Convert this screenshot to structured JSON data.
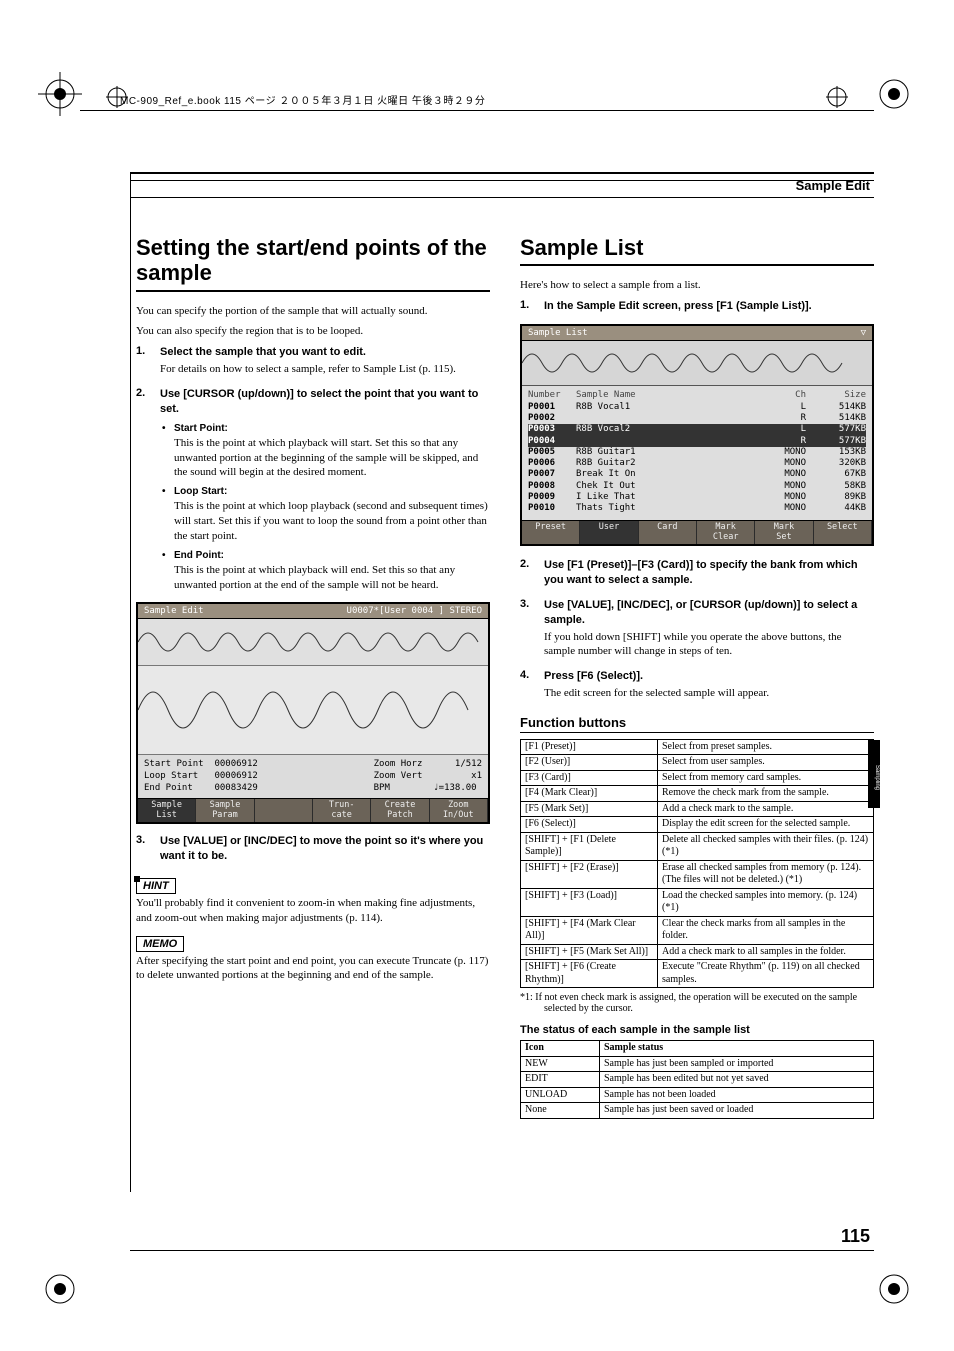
{
  "book_header": "MC-909_Ref_e.book 115 ページ ２００５年３月１日 火曜日 午後３時２９分",
  "page_header": "Sample Edit",
  "page_number": "115",
  "side_tab": "Sampling",
  "left": {
    "h2": "Setting the start/end points of the sample",
    "intro1": "You can specify the portion of the sample that will actually sound.",
    "intro2": "You can also specify the region that is to be looped.",
    "steps": [
      {
        "head": "Select the sample that you want to edit.",
        "body": "For details on how to select a sample, refer to Sample List (p. 115)."
      },
      {
        "head": "Use [CURSOR (up/down)] to select the point that you want to set.",
        "bullets": [
          {
            "label": "Start Point:",
            "desc": "This is the point at which playback will start. Set this so that any unwanted portion at the beginning of the sample will be skipped, and the sound will begin at the desired moment."
          },
          {
            "label": "Loop Start:",
            "desc": "This is the point at which loop playback (second and subsequent times) will start. Set this if you want to loop the sound from a point other than the start point."
          },
          {
            "label": "End Point:",
            "desc": "This is the point at which playback will end. Set this so that any unwanted portion at the end of the sample will not be heard."
          }
        ]
      },
      {
        "head": "Use [VALUE] or [INC/DEC] to move the point so it's where you want it to be."
      }
    ],
    "sshot": {
      "title_left": "Sample Edit",
      "title_right": "U0007*[User 0004         ] STEREO",
      "params_left": [
        "Start Point  00006912",
        "Loop Start   00006912",
        "End Point    00083429"
      ],
      "params_right": [
        "Zoom Horz      1/512",
        "Zoom Vert         x1",
        "BPM        ♩=138.00"
      ],
      "fkeys": [
        "Sample\nList",
        "Sample\nParam",
        "",
        "Trun-\ncate",
        "Create\nPatch",
        "Zoom\nIn/Out"
      ]
    },
    "hint_tag": "HINT",
    "hint_body": "You'll probably find it convenient to zoom-in when making fine adjustments, and zoom-out when making major adjustments (p. 114).",
    "memo_tag": "MEMO",
    "memo_body": "After specifying the start point and end point, you can execute Truncate (p. 117) to delete unwanted portions at the beginning and end of the sample."
  },
  "right": {
    "h2": "Sample List",
    "intro": "Here's how to select a sample from a list.",
    "steps": [
      {
        "head": "In the Sample Edit screen, press [F1 (Sample List)]."
      },
      {
        "head": "Use [F1 (Preset)]–[F3 (Card)] to specify the bank from which you want to select a sample."
      },
      {
        "head": "Use [VALUE], [INC/DEC], or [CURSOR (up/down)] to select a sample.",
        "body": "If you hold down [SHIFT] while you operate the above buttons, the sample number will change in steps of ten."
      },
      {
        "head": "Press [F6 (Select)].",
        "body": "The edit screen for the selected sample will appear."
      }
    ],
    "sl_sshot": {
      "title": "Sample List",
      "head": [
        "Number",
        "Sample Name",
        "Ch",
        "Size"
      ],
      "rows": [
        {
          "n": "P0001",
          "name": "R8B Vocal1",
          "ch": "L",
          "size": "514KB"
        },
        {
          "n": "P0002",
          "name": "",
          "ch": "R",
          "size": "514KB"
        },
        {
          "n": "P0003",
          "name": "R8B Vocal2",
          "ch": "L",
          "size": "577KB",
          "sel": true
        },
        {
          "n": "P0004",
          "name": "",
          "ch": "R",
          "size": "577KB",
          "sel": true
        },
        {
          "n": "P0005",
          "name": "R8B Guitar1",
          "ch": "MONO",
          "size": "153KB"
        },
        {
          "n": "P0006",
          "name": "R8B Guitar2",
          "ch": "MONO",
          "size": "320KB"
        },
        {
          "n": "P0007",
          "name": "Break It On",
          "ch": "MONO",
          "size": "67KB"
        },
        {
          "n": "P0008",
          "name": "Chek It Out",
          "ch": "MONO",
          "size": "58KB"
        },
        {
          "n": "P0009",
          "name": "I Like That",
          "ch": "MONO",
          "size": "89KB"
        },
        {
          "n": "P0010",
          "name": "Thats Tight",
          "ch": "MONO",
          "size": "44KB"
        }
      ],
      "fkeys": [
        "Preset",
        "User",
        "Card",
        "Mark\nClear",
        "Mark\nSet",
        "Select"
      ]
    },
    "fn_heading": "Function buttons",
    "fn_rows": [
      {
        "k": "[F1 (Preset)]",
        "v": "Select from preset samples."
      },
      {
        "k": "[F2 (User)]",
        "v": "Select from user samples."
      },
      {
        "k": "[F3 (Card)]",
        "v": "Select from memory card samples."
      },
      {
        "k": "[F4 (Mark Clear)]",
        "v": "Remove the check mark from the sample."
      },
      {
        "k": "[F5 (Mark Set)]",
        "v": "Add a check mark to the sample."
      },
      {
        "k": "[F6 (Select)]",
        "v": "Display the edit screen for the selected sample."
      },
      {
        "k": "[SHIFT] + [F1 (Delete Sample)]",
        "v": "Delete all checked samples with their files. (p. 124) (*1)"
      },
      {
        "k": "[SHIFT] + [F2 (Erase)]",
        "v": "Erase all checked samples from memory (p. 124). (The files will not be deleted.) (*1)"
      },
      {
        "k": "[SHIFT] + [F3 (Load)]",
        "v": "Load the checked samples into memory. (p. 124) (*1)"
      },
      {
        "k": "[SHIFT] + [F4 (Mark Clear All)]",
        "v": "Clear the check marks from all samples in the folder."
      },
      {
        "k": "[SHIFT] + [F5 (Mark Set All)]",
        "v": "Add a check mark to all samples in the folder."
      },
      {
        "k": "[SHIFT] + [F6 (Create Rhythm)]",
        "v": "Execute \"Create Rhythm\" (p. 119) on all checked samples."
      }
    ],
    "footnote_label": "*1:",
    "footnote": "If not even check mark is assigned, the operation will be executed on the sample selected by the cursor.",
    "status_heading": "The status of each sample in the sample list",
    "status_head": [
      "Icon",
      "Sample status"
    ],
    "status_rows": [
      {
        "icon": "NEW",
        "v": "Sample has just been sampled or imported"
      },
      {
        "icon": "EDIT",
        "v": "Sample has been edited but not yet saved"
      },
      {
        "icon": "UNLOAD",
        "v": "Sample has not been loaded"
      },
      {
        "icon": "None",
        "v": "Sample has just been saved or loaded"
      }
    ]
  }
}
